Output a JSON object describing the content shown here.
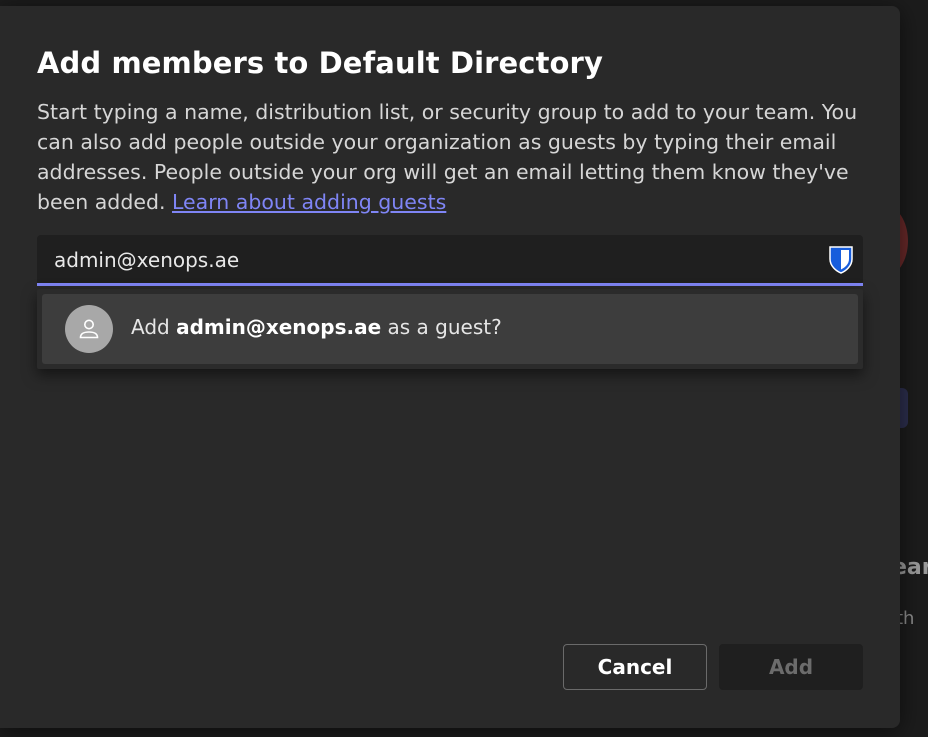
{
  "dialog": {
    "title": "Add members to Default Directory",
    "description": "Start typing a name, distribution list, or security group to add to your team. You can also add people outside your organization as guests by typing their email addresses. People outside your org will get an email letting them know they've been added. ",
    "learn_link": "Learn about adding guests"
  },
  "search": {
    "value": "admin@xenops.ae",
    "placeholder": ""
  },
  "suggestion": {
    "prefix": "Add ",
    "email": "admin@xenops.ae",
    "suffix": " as a guest?"
  },
  "buttons": {
    "cancel": "Cancel",
    "add": "Add"
  },
  "background": {
    "text_fragment_1": "ear",
    "text_fragment_2": "th"
  },
  "colors": {
    "accent": "#7f85f5",
    "dialog_bg": "#292929",
    "shield_blue": "#175ddc"
  },
  "icons": {
    "password_manager": "shield-icon",
    "guest_avatar": "person-icon"
  }
}
